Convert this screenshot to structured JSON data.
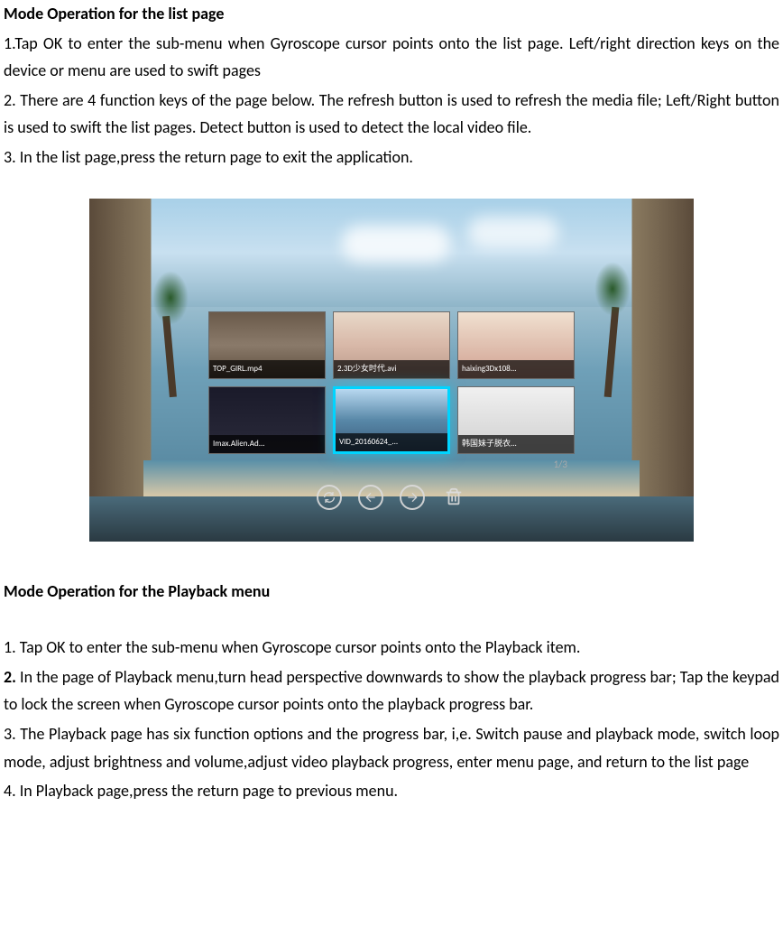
{
  "section1": {
    "heading": "Mode Operation for the list page",
    "p1": "1.Tap OK to enter the sub-menu when Gyroscope cursor points onto the list page. Left/right direction keys on the device or menu are used to swift pages",
    "p2": "2.  There are 4 function keys of the page below. The refresh button is used to refresh the media file; Left/Right button is used to swift the list pages. Detect button is used to detect the local video file.",
    "p3": "3. In the list page,press the return page to exit the application."
  },
  "screenshot": {
    "thumbs": [
      {
        "label": "TOP_GIRL.mp4"
      },
      {
        "label": "2.3D少女时代.avi"
      },
      {
        "label": "haixing3Dx108..."
      },
      {
        "label": "Imax.Alien.Ad..."
      },
      {
        "label": "VID_20160624_..."
      },
      {
        "label": "韩国妹子脱衣..."
      }
    ],
    "pageIndicator": "1/3",
    "toolbar": {
      "refresh": "refresh-icon",
      "prev": "arrow-left-icon",
      "next": "arrow-right-icon",
      "delete": "trash-icon"
    }
  },
  "section2": {
    "heading": "Mode Operation for the Playback menu",
    "p1": "1.  Tap OK to enter the sub-menu when Gyroscope cursor points onto the Playback item.",
    "p2_prefix": "2.",
    "p2_rest": " In the page of Playback menu,turn head perspective downwards to show the playback progress bar; Tap the keypad to lock the screen when Gyroscope cursor points onto the playback progress bar.",
    "p3": "3. The Playback page has six function options and the progress bar, i,e. Switch pause and playback mode, switch loop mode, adjust brightness and volume,adjust video playback progress, enter menu page, and return to the list page",
    "p4": "4.  In Playback page,press the return page to previous menu."
  }
}
